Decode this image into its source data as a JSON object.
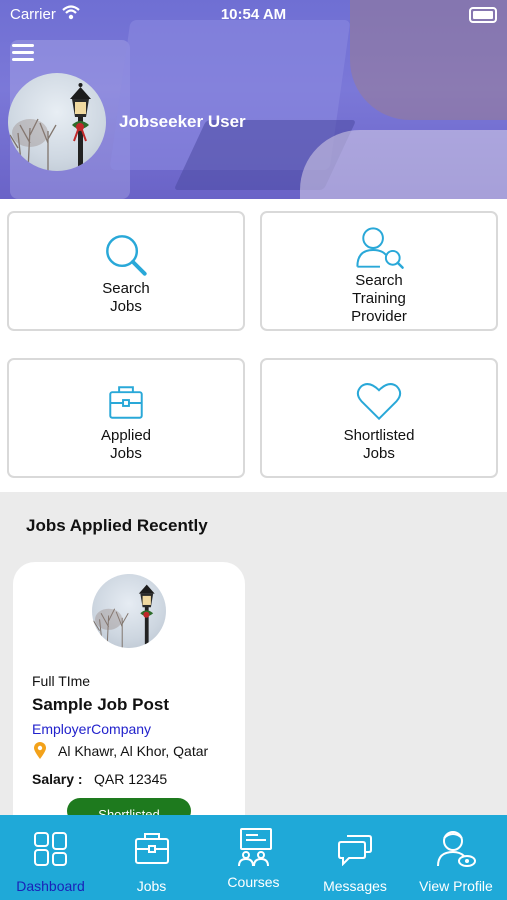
{
  "status_bar": {
    "carrier": "Carrier",
    "time": "10:54 AM"
  },
  "header": {
    "user_name": "Jobseeker User"
  },
  "tiles": [
    {
      "label": "Search\nJobs",
      "icon": "search-icon"
    },
    {
      "label": "Search\nTraining\nProvider",
      "icon": "user-search-icon"
    },
    {
      "label": "Applied\nJobs",
      "icon": "briefcase-icon"
    },
    {
      "label": "Shortlisted\nJobs",
      "icon": "heart-icon"
    }
  ],
  "recent": {
    "title": "Jobs Applied Recently",
    "job": {
      "type": "Full TIme",
      "title": "Sample Job Post",
      "company": "EmployerCompany",
      "location": "Al Khawr, Al Khor, Qatar",
      "salary_label": "Salary :",
      "salary_value": "QAR 12345",
      "status": "Shortlisted"
    }
  },
  "tabbar": {
    "active": "Dashboard",
    "items": [
      {
        "label": "Dashboard",
        "icon": "dashboard-icon"
      },
      {
        "label": "Jobs",
        "icon": "briefcase-icon"
      },
      {
        "label": "Courses",
        "icon": "courses-icon"
      },
      {
        "label": "Messages",
        "icon": "messages-icon"
      },
      {
        "label": "View Profile",
        "icon": "profile-icon"
      }
    ]
  },
  "colors": {
    "accent": "#1fa9d8",
    "active_tab": "#1a22b8",
    "company_link": "#2222cc",
    "badge": "#1e7a1e",
    "icon": "#29a8d8"
  }
}
